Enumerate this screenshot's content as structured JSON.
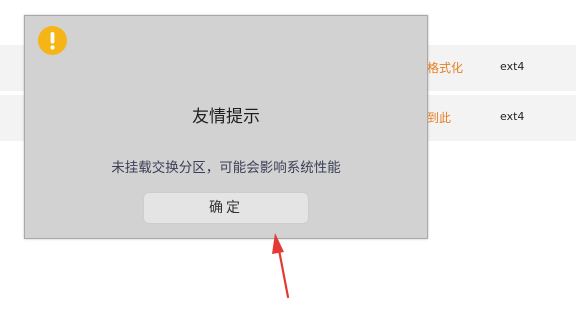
{
  "background_table": {
    "rows": [
      {
        "action": "格式化",
        "filesystem": "ext4"
      },
      {
        "action": "到此",
        "filesystem": "ext4"
      }
    ]
  },
  "dialog": {
    "icon": "warning-icon",
    "title": "友情提示",
    "message": "未挂载交换分区，可能会影响系统性能",
    "ok_label": "确定"
  },
  "colors": {
    "dialog_bg": "#d2d2d2",
    "warning_icon": "#f6b516",
    "action_text": "#e67e22",
    "annotation_arrow": "#e53935"
  }
}
